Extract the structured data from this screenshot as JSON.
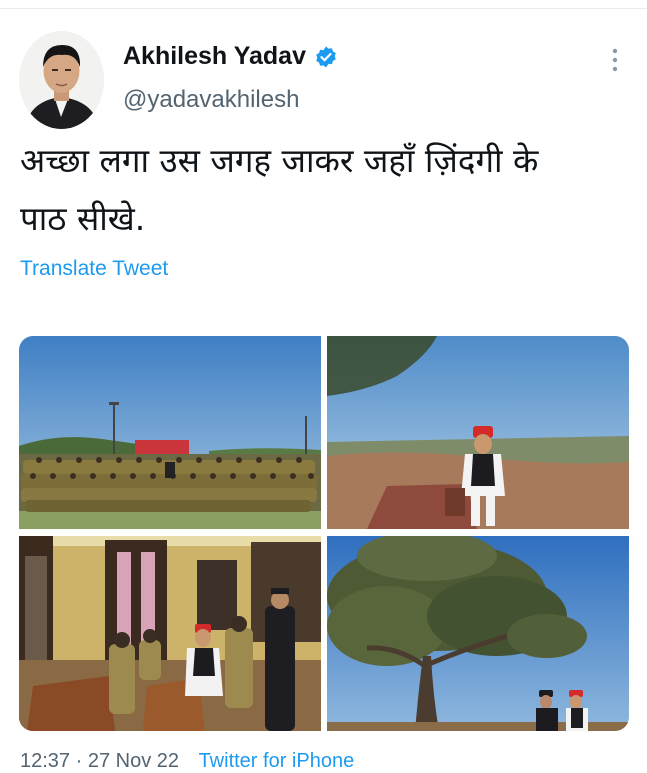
{
  "tweet": {
    "author": {
      "name": "Akhilesh Yadav",
      "handle": "@yadavakhilesh",
      "verified": true,
      "avatar": "profile-photo"
    },
    "text_line1": "अच्छा लगा उस जगह जाकर जहाँ ज़िंदगी के",
    "text_line2": "पाठ सीखे.",
    "translate_label": "Translate Tweet",
    "media": [
      {
        "name": "photo-cadets-group",
        "depicts": "large group of cadets in khaki uniforms posing outdoors"
      },
      {
        "name": "photo-hilltop-man",
        "depicts": "man in white kurta and black vest standing on rocky hilltop"
      },
      {
        "name": "photo-classroom",
        "depicts": "man seated at wooden desks with cadets and officer in classroom"
      },
      {
        "name": "photo-tree-sky",
        "depicts": "large tree against blue sky with two men standing below"
      }
    ],
    "footer_partial": {
      "timestamp": "12:37 · 27 Nov 22",
      "source": "Twitter for iPhone"
    }
  },
  "colors": {
    "accent": "#1d9bf0",
    "text": "#0f1419",
    "muted": "#536471"
  },
  "icons": [
    "verified-badge-icon",
    "more-options-icon"
  ]
}
